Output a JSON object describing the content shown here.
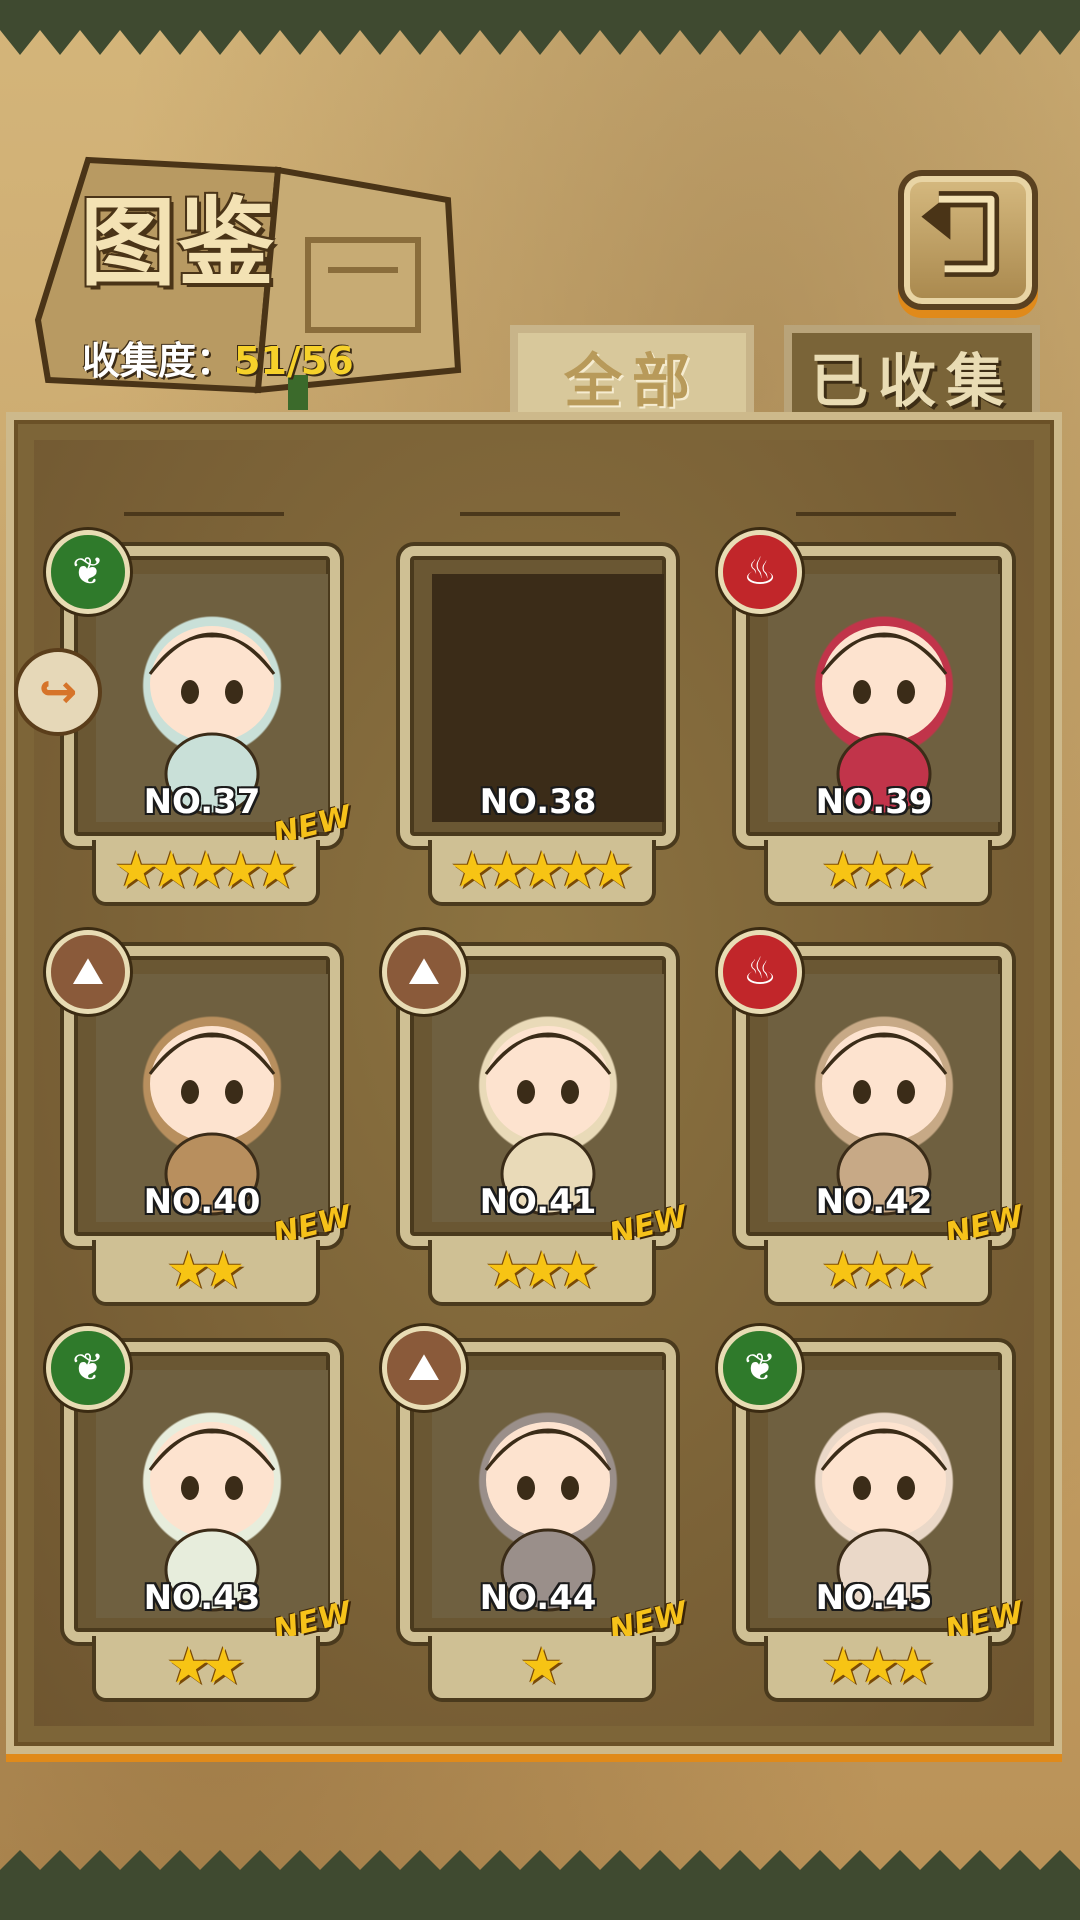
{
  "header": {
    "title": "图鉴",
    "collection_label": "收集度：",
    "collection_value": "51/56"
  },
  "tabs": [
    {
      "label": "全部",
      "active": true
    },
    {
      "label": "已收集",
      "active": false
    }
  ],
  "back_button": {
    "icon": "return-arrow-icon"
  },
  "cards": [
    {
      "number": "NO.37",
      "stars": 5,
      "element": "leaf",
      "new": true,
      "collected": true
    },
    {
      "number": "NO.38",
      "stars": 5,
      "element": null,
      "new": false,
      "collected": false
    },
    {
      "number": "NO.39",
      "stars": 3,
      "element": "fire",
      "new": false,
      "collected": true
    },
    {
      "number": "NO.40",
      "stars": 2,
      "element": "earth",
      "new": true,
      "collected": true
    },
    {
      "number": "NO.41",
      "stars": 3,
      "element": "earth",
      "new": true,
      "collected": true
    },
    {
      "number": "NO.42",
      "stars": 3,
      "element": "fire",
      "new": true,
      "collected": true
    },
    {
      "number": "NO.43",
      "stars": 2,
      "element": "leaf",
      "new": true,
      "collected": true
    },
    {
      "number": "NO.44",
      "stars": 1,
      "element": "earth",
      "new": true,
      "collected": true
    },
    {
      "number": "NO.45",
      "stars": 3,
      "element": "leaf",
      "new": true,
      "collected": true
    }
  ],
  "new_badge": "NEW",
  "star_glyph": "★",
  "element_icons": {
    "leaf": "❦",
    "fire": "♨",
    "earth": "⛰"
  },
  "side_icon": "↪",
  "colors": {
    "star": "#f7c414",
    "accent": "#f6d12a",
    "leaf": "#2f7a2b",
    "fire": "#c1262a",
    "earth": "#8a5a3a"
  }
}
